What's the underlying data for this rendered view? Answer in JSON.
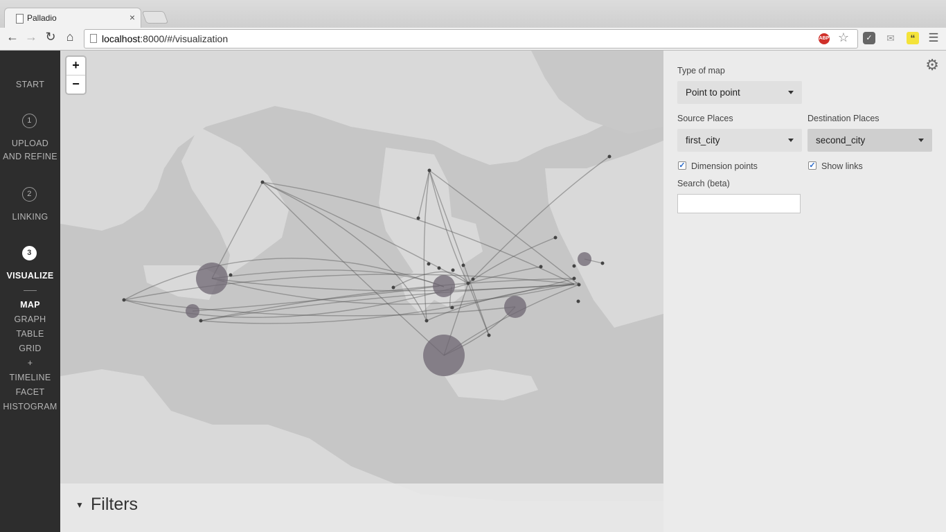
{
  "browser": {
    "tab_title": "Palladio",
    "tab_close": "×",
    "url_host": "localhost",
    "url_rest": ":8000/#/visualization",
    "icons": [
      "back-icon",
      "forward-icon",
      "reload-icon",
      "home-icon",
      "page-icon",
      "adblock-icon",
      "star-icon",
      "pocket-icon",
      "mail-icon",
      "quote-icon",
      "menu-icon"
    ],
    "abp_text": "ABP"
  },
  "sidebar": {
    "start": "START",
    "steps": [
      {
        "number": "1",
        "line1": "UPLOAD",
        "line2": "AND REFINE"
      },
      {
        "number": "2",
        "line1": "LINKING",
        "line2": ""
      },
      {
        "number": "3",
        "line1": "VISUALIZE",
        "line2": ""
      }
    ],
    "views": [
      "MAP",
      "GRAPH",
      "TABLE",
      "GRID",
      "+",
      "TIMELINE",
      "FACET",
      "HISTOGRAM"
    ],
    "active_view": "MAP"
  },
  "map": {
    "zoom_in": "+",
    "zoom_out": "−",
    "filters_label": "Filters",
    "filter_icon": "funnel-icon",
    "colors": {
      "land": "#d9d9d9",
      "sea": "#c6c6c6",
      "node": "#6e6672",
      "link": "#555555"
    }
  },
  "panel": {
    "type_of_map_label": "Type of map",
    "type_of_map_value": "Point to point",
    "source_label": "Source Places",
    "source_value": "first_city",
    "destination_label": "Destination Places",
    "destination_value": "second_city",
    "dimension_points_label": "Dimension points",
    "dimension_points_checked": true,
    "show_links_label": "Show links",
    "show_links_checked": true,
    "search_label": "Search (beta)",
    "search_value": "",
    "settings_icon": "gear-icon"
  }
}
